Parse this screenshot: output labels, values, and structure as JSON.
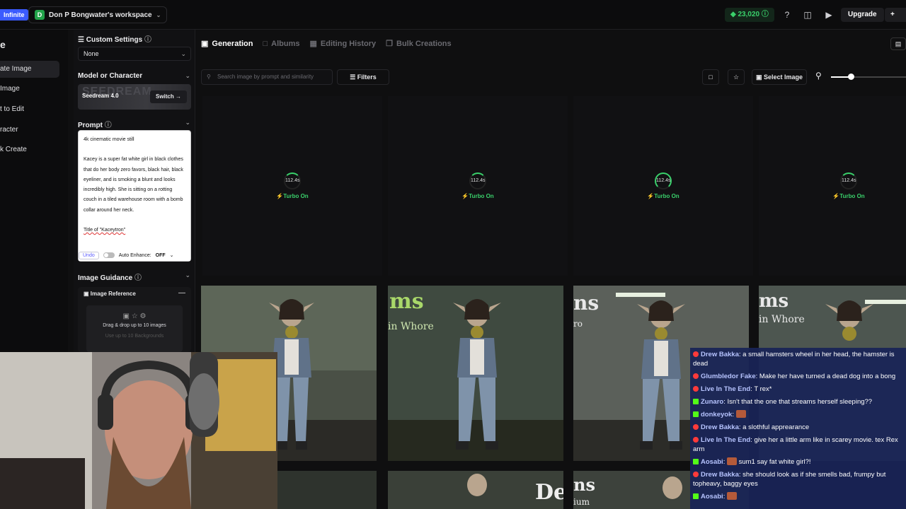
{
  "topbar": {
    "plan_badge": "Infinite",
    "workspace_initial": "D",
    "workspace_name": "Don P Bongwater's workspace",
    "credits": "23,020",
    "upgrade_label": "Upgrade",
    "create_label": "+ C"
  },
  "leftnav": {
    "heading": "e",
    "items": [
      "ate Image",
      "Image",
      "t to Edit",
      "racter",
      "k Create"
    ]
  },
  "settings": {
    "custom_settings_label": "Custom Settings",
    "custom_settings_value": "None",
    "model_section_label": "Model or Character",
    "model_bg_text": "SEEDREAM",
    "model_name": "Seedream 4.0",
    "switch_label": "Switch",
    "prompt_label": "Prompt",
    "prompt_lines": [
      "4k cinematic movie still",
      "",
      "Kacey is a super fat white girl in black clothes that do her body zero favors, black hair, black eyeliner, and is smoking a blunt and looks incredibly high. She is sitting on a rotting couch in a tiled warehouse room with a bomb collar around her neck.",
      "",
      "Title of \"Kaceytron\""
    ],
    "undo_label": "Undo",
    "auto_enhance_label": "Auto Enhance:",
    "auto_enhance_value": "OFF",
    "image_guidance_label": "Image Guidance",
    "image_reference_label": "Image Reference",
    "drop_text": "Drag & drop up to 10 images",
    "drop_subtext": "Use up to 10 Backgrounds"
  },
  "main": {
    "tabs": [
      "Generation",
      "Albums",
      "Editing History",
      "Bulk Creations"
    ],
    "search_placeholder": "Search image by prompt and similarity",
    "filters_label": "Filters",
    "select_image_label": "Select Image",
    "zoom_level": 0.26
  },
  "generation_cards": [
    {
      "time": "112.4s",
      "mode": "Turbo On"
    },
    {
      "time": "112.4s",
      "mode": "Turbo On"
    },
    {
      "time": "112.4s",
      "mode": "Turbo On"
    },
    {
      "time": "112.4s",
      "mode": "Turbo On"
    }
  ],
  "image_texts": [
    "ms",
    "in Whore",
    "ns",
    "ro",
    "ms",
    "in Whore",
    "Dei",
    "ns",
    "ium"
  ],
  "chat": [
    {
      "platform": "yt",
      "user": "Drew Bakka",
      "text": "a small hamsters wheel in her head, the hamster is dead"
    },
    {
      "platform": "yt",
      "user": "Glumbledor Fake",
      "text": "Make her have turned a dead dog into a bong"
    },
    {
      "platform": "yt",
      "user": "Live In The End",
      "text": "T rex*"
    },
    {
      "platform": "kick",
      "user": "Zunaro",
      "text": "Isn't that the one that streams herself sleeping??"
    },
    {
      "platform": "kick",
      "user": "donkeyok",
      "text": ""
    },
    {
      "platform": "yt",
      "user": "Drew Bakka",
      "text": "a slothful apprearance"
    },
    {
      "platform": "yt",
      "user": "Live In The End",
      "text": "give her a little arm like in scarey movie. tex Rex arm"
    },
    {
      "platform": "kick",
      "user": "Aosabi",
      "text": "sum1 say fat white girl?!"
    },
    {
      "platform": "yt",
      "user": "Drew Bakka",
      "text": "she should look as if she smells bad, frumpy but topheavy, baggy eyes"
    },
    {
      "platform": "kick",
      "user": "Aosabi",
      "text": ""
    }
  ],
  "colors": {
    "accent_green": "#3ad06b",
    "badge_blue": "#3b5bff",
    "chat_bg": "#1a2456"
  }
}
